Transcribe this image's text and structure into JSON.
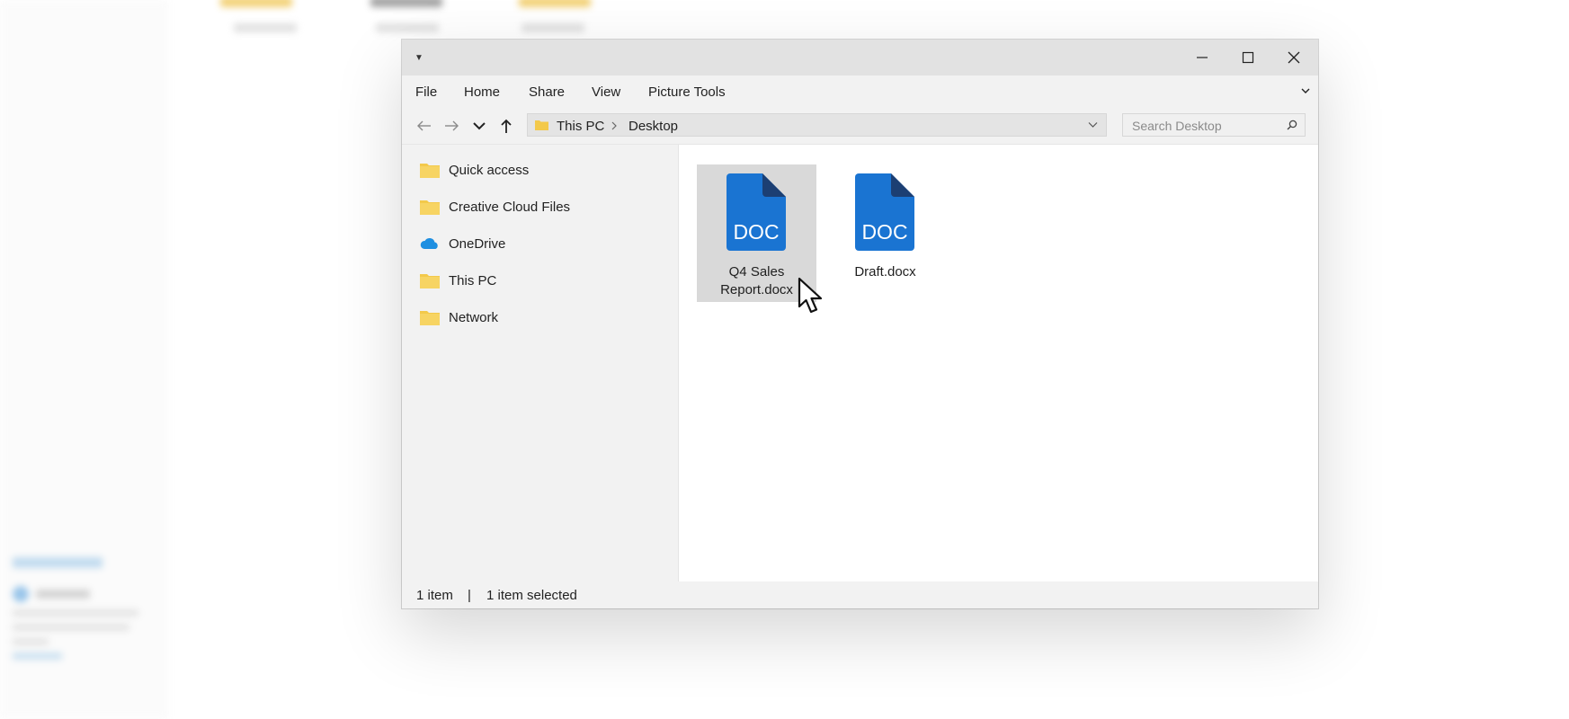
{
  "window": {
    "menu": [
      "File",
      "Home",
      "Share",
      "View",
      "Picture Tools"
    ]
  },
  "address": {
    "crumbs": [
      "This PC",
      "Desktop"
    ],
    "search_placeholder": "Search Desktop"
  },
  "sidebar": {
    "items": [
      {
        "label": "Quick access",
        "icon": "folder-icon"
      },
      {
        "label": "Creative Cloud Files",
        "icon": "folder-icon"
      },
      {
        "label": "OneDrive",
        "icon": "cloud-icon"
      },
      {
        "label": "This PC",
        "icon": "folder-icon"
      },
      {
        "label": "Network",
        "icon": "folder-icon"
      }
    ]
  },
  "files": [
    {
      "badge": "DOC",
      "name_line1": "Q4 Sales",
      "name_line2": "Report.docx",
      "selected": true
    },
    {
      "badge": "DOC",
      "name_line1": "Draft.docx",
      "name_line2": "",
      "selected": false
    }
  ],
  "status": {
    "count": "1 item",
    "separator": "|",
    "selection": "1 item selected"
  },
  "colors": {
    "doc_blue": "#1a74d2",
    "doc_fold": "#1c3f73",
    "folder": "#f3c94b",
    "onedrive": "#1e8fe1",
    "selection": "#d9d9d9"
  }
}
